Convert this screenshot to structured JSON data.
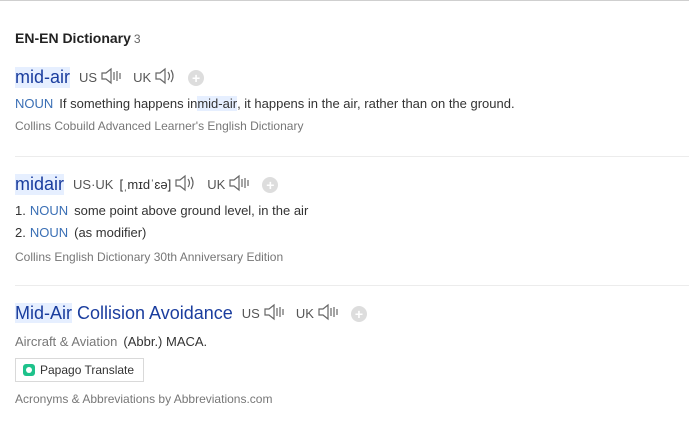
{
  "section": {
    "title": "EN-EN Dictionary",
    "count": "3"
  },
  "entries": [
    {
      "headword": "mid-air",
      "us_label": "US",
      "uk_label": "UK",
      "definition": {
        "pos": "NOUN",
        "text_before": "If something happens in ",
        "highlight": "mid-air",
        "text_after": ", it happens in the air, rather than on the ground."
      },
      "source": "Collins Cobuild Advanced Learner's English Dictionary"
    },
    {
      "headword": "midair",
      "us_uk_label": "US·UK",
      "ipa": "[ˌmɪdˈɛə]",
      "uk_label": "UK",
      "senses": [
        {
          "num": "1.",
          "pos": "NOUN",
          "text": "some point above ground level, in the air"
        },
        {
          "num": "2.",
          "pos": "NOUN",
          "text": "(as modifier)"
        }
      ],
      "source": "Collins English Dictionary 30th Anniversary Edition"
    },
    {
      "headword_hl": "Mid-Air",
      "headword_rest": " Collision Avoidance",
      "us_label": "US",
      "uk_label": "UK",
      "domain": "Aircraft & Aviation",
      "definition": "(Abbr.) MACA.",
      "papago_label": "Papago Translate",
      "source": "Acronyms & Abbreviations by Abbreviations.com"
    }
  ]
}
